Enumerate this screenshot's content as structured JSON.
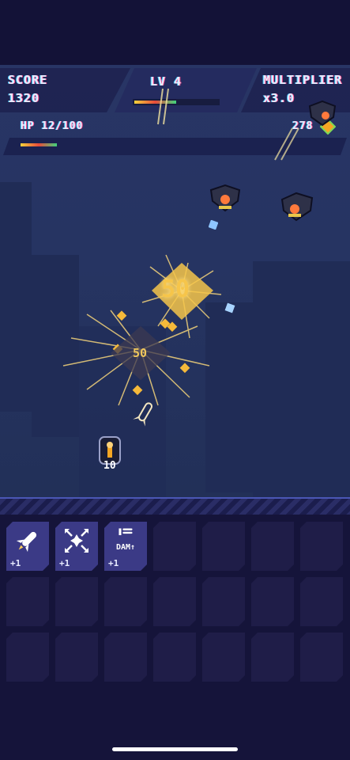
{
  "hud": {
    "score_label": "SCORE",
    "score_value": "1320",
    "level_label": "LV 4",
    "multiplier_label": "MULTIPLIER",
    "multiplier_value": "x3.0",
    "hp_label": "HP 12/100",
    "coins_value": "278",
    "level_progress": 0.5,
    "hp_fraction": 0.12
  },
  "popups": {
    "big_hit": "50",
    "small_hit": "50",
    "player_damage": "10"
  },
  "inventory": {
    "slots": [
      {
        "icon": "rocket-icon",
        "count": "+1"
      },
      {
        "icon": "burst-arrows-icon",
        "count": "+1"
      },
      {
        "icon": "bullets-icon",
        "label": "DAM↑",
        "count": "+1"
      }
    ]
  },
  "colors": {
    "background": "#121032",
    "game_bg": "#283565",
    "accent_gold": "#f6c54a",
    "slot_filled": "#3b3a86",
    "slot_empty": "#1f1d48"
  }
}
